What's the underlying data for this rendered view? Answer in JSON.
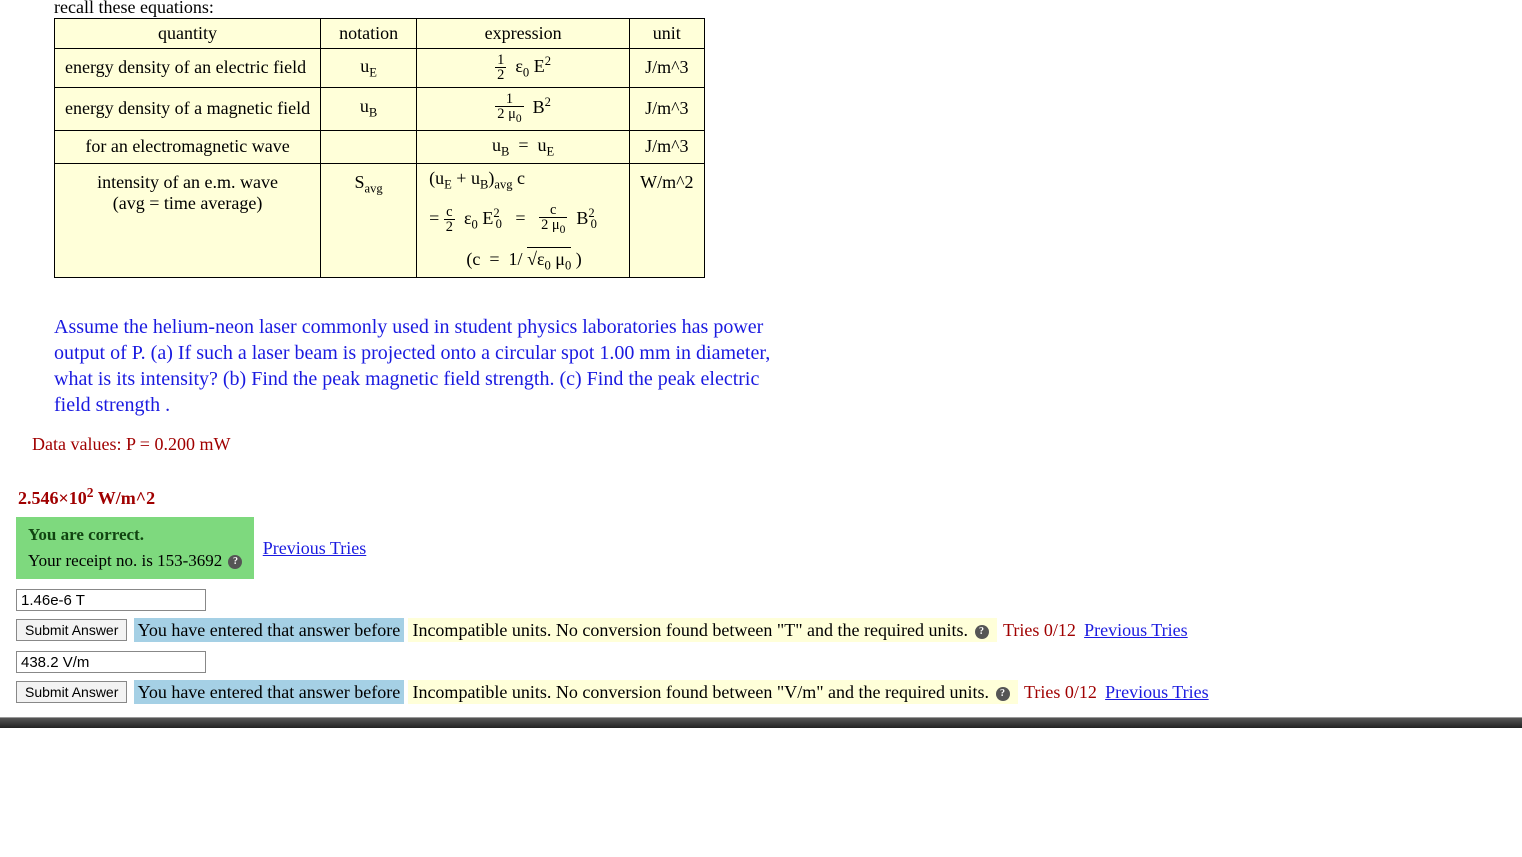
{
  "recall": "recall these equations:",
  "table": {
    "headers": [
      "quantity",
      "notation",
      "expression",
      "unit"
    ],
    "rows": [
      {
        "quantity": "energy density of an electric field",
        "notation": "u_E",
        "unit": "J/m^3"
      },
      {
        "quantity": "energy density of a magnetic field",
        "notation": "u_B",
        "unit": "J/m^3"
      },
      {
        "quantity": "for an electromagnetic wave",
        "notation": "",
        "unit": "J/m^3"
      },
      {
        "quantity1": "intensity of an e.m. wave",
        "quantity2": "(avg  =  time average)",
        "notation": "S_avg",
        "unit": "W/m^2"
      }
    ]
  },
  "question": "Assume the helium-neon laser commonly used in student physics laboratories has power output of P. (a) If such a laser beam is projected onto a circular spot 1.00 mm in diameter, what is its intensity? (b) Find the peak magnetic field strength. (c) Find the peak electric field strength .",
  "data_values": "Data values: P = 0.200 mW",
  "partA": {
    "answer_html": "2.546×10<sup>2</sup> W/m^2",
    "correct_line1": "You are correct.",
    "correct_line2": "Your receipt no. is 153-3692",
    "prev_tries": "Previous Tries"
  },
  "partB": {
    "input_value": "1.46e-6 T",
    "submit_label": "Submit Answer",
    "entered_before": "You have entered that answer before",
    "incompat": "Incompatible units. No conversion found between \"T\" and the required units.",
    "tries": "Tries 0/12",
    "prev_tries": "Previous Tries"
  },
  "partC": {
    "input_value": "438.2 V/m",
    "submit_label": "Submit Answer",
    "entered_before": "You have entered that answer before",
    "incompat": "Incompatible units. No conversion found between \"V/m\" and the required units.",
    "tries": "Tries 0/12",
    "prev_tries": "Previous Tries"
  },
  "help_glyph": "?"
}
